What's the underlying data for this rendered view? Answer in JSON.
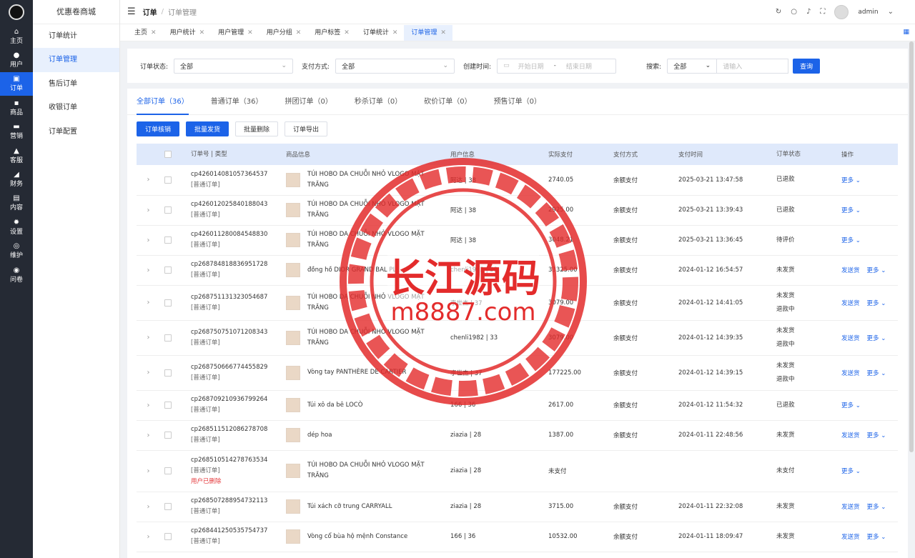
{
  "rail": {
    "items": [
      {
        "label": "主页",
        "icon": "home-icon",
        "glyph": "⌂"
      },
      {
        "label": "用户",
        "icon": "user-icon",
        "glyph": "●"
      },
      {
        "label": "订单",
        "icon": "order-icon",
        "glyph": "▣"
      },
      {
        "label": "商品",
        "icon": "goods-icon",
        "glyph": "▪"
      },
      {
        "label": "营销",
        "icon": "marketing-icon",
        "glyph": "▬"
      },
      {
        "label": "客服",
        "icon": "service-icon",
        "glyph": "▲"
      },
      {
        "label": "财务",
        "icon": "finance-icon",
        "glyph": "◢"
      },
      {
        "label": "内容",
        "icon": "content-icon",
        "glyph": "▤"
      },
      {
        "label": "设置",
        "icon": "settings-icon",
        "glyph": "✹"
      },
      {
        "label": "维护",
        "icon": "maintenance-icon",
        "glyph": "◎"
      },
      {
        "label": "问卷",
        "icon": "survey-icon",
        "glyph": "◉"
      }
    ]
  },
  "subnav": {
    "title": "优惠卷商城",
    "items": [
      {
        "label": "订单统计"
      },
      {
        "label": "订单管理"
      },
      {
        "label": "售后订单"
      },
      {
        "label": "收银订单"
      },
      {
        "label": "订单配置"
      }
    ]
  },
  "topbar": {
    "breadcrumb1": "订单",
    "breadcrumb_sep": "/",
    "breadcrumb2": "订单管理",
    "username": "admin"
  },
  "tabs": [
    {
      "label": "主页"
    },
    {
      "label": "用户统计"
    },
    {
      "label": "用户管理"
    },
    {
      "label": "用户分组"
    },
    {
      "label": "用户标签"
    },
    {
      "label": "订单统计"
    },
    {
      "label": "订单管理"
    }
  ],
  "filters": {
    "status_label": "订单状态:",
    "status_value": "全部",
    "pay_label": "支付方式:",
    "pay_value": "全部",
    "time_label": "创建时间:",
    "date_start": "开始日期",
    "date_sep": "-",
    "date_end": "结束日期",
    "search_label": "搜索:",
    "search_scope": "全部",
    "search_placeholder": "请输入",
    "query_label": "查询"
  },
  "order_tabs": [
    {
      "label": "全部订单（36）"
    },
    {
      "label": "普通订单（36）"
    },
    {
      "label": "拼团订单（0）"
    },
    {
      "label": "秒杀订单（0）"
    },
    {
      "label": "砍价订单（0）"
    },
    {
      "label": "预售订单（0）"
    }
  ],
  "actions": {
    "verify": "订单核销",
    "batch_ship": "批量发货",
    "batch_delete": "批量删除",
    "export": "订单导出"
  },
  "table": {
    "headers": {
      "order_no": "订单号 | 类型",
      "goods": "商品信息",
      "user": "用户信息",
      "paid": "实际支付",
      "method": "支付方式",
      "time": "支付时间",
      "status": "订单状态",
      "op": "操作"
    },
    "rows": [
      {
        "no": "cp426014081057364537",
        "type": "[普通订单]",
        "goods": "TÚI HOBO DA CHUỖI NHỎ VLOGO MẶT TRĂNG",
        "user": "阿达 | 38",
        "paid": "2740.05",
        "method": "余额支付",
        "time": "2025-03-21 13:47:58",
        "status": "已退款",
        "status2": "",
        "ship": "",
        "more": "更多 ⌄",
        "deleted": ""
      },
      {
        "no": "cp426012025840188043",
        "type": "[普通订单]",
        "goods": "TÚI HOBO DA CHUỖI NHỎ VLOGO MẶT TRĂNG",
        "user": "阿达 | 38",
        "paid": "2925.00",
        "method": "余额支付",
        "time": "2025-03-21 13:39:43",
        "status": "已退款",
        "status2": "",
        "ship": "",
        "more": "更多 ⌄",
        "deleted": ""
      },
      {
        "no": "cp426011280084548830",
        "type": "[普通订单]",
        "goods": "TÚI HOBO DA CHUỖI NHỎ VLOGO MẶT TRĂNG",
        "user": "阿达 | 38",
        "paid": "3048.21",
        "method": "余额支付",
        "time": "2025-03-21 13:36:45",
        "status": "待评价",
        "status2": "",
        "ship": "",
        "more": "更多 ⌄",
        "deleted": ""
      },
      {
        "no": "cp268784818836951728",
        "type": "[普通订单]",
        "goods": "đồng hồ DIOR GRAND BAL PL...",
        "user": "chenli1982 | 33",
        "paid": "33325.00",
        "method": "余额支付",
        "time": "2024-01-12 16:54:57",
        "status": "未发货",
        "status2": "",
        "ship": "发送货",
        "more": "更多 ⌄",
        "deleted": ""
      },
      {
        "no": "cp268751131323054687",
        "type": "[普通订单]",
        "goods": "TÚI HOBO DA CHUỖI NHỎ VLOGO MẶT TRĂNG",
        "user": "李世杰 | 37",
        "paid": "3079.00",
        "method": "余额支付",
        "time": "2024-01-12 14:41:05",
        "status": "未发货",
        "status2": "退款中",
        "ship": "发送货",
        "more": "更多 ⌄",
        "deleted": ""
      },
      {
        "no": "cp268750751071208343",
        "type": "[普通订单]",
        "goods": "TÚI HOBO DA CHUỖI NHỎ VLOGO MẶT TRĂNG",
        "user": "chenli1982 | 33",
        "paid": "3079.00",
        "method": "余额支付",
        "time": "2024-01-12 14:39:35",
        "status": "未发货",
        "status2": "退款中",
        "ship": "发送货",
        "more": "更多 ⌄",
        "deleted": ""
      },
      {
        "no": "cp268750666774455829",
        "type": "[普通订单]",
        "goods": "Vòng tay PANTHÈRE DE CARTIER",
        "user": "李世杰 | 37",
        "paid": "177225.00",
        "method": "余额支付",
        "time": "2024-01-12 14:39:15",
        "status": "未发货",
        "status2": "退款中",
        "ship": "发送货",
        "more": "更多 ⌄",
        "deleted": ""
      },
      {
        "no": "cp268709210936799264",
        "type": "[普通订单]",
        "goods": "Túi xô da bê LOCÒ",
        "user": "166 | 36",
        "paid": "2617.00",
        "method": "余额支付",
        "time": "2024-01-12 11:54:32",
        "status": "已退款",
        "status2": "",
        "ship": "",
        "more": "更多 ⌄",
        "deleted": ""
      },
      {
        "no": "cp268511512086278708",
        "type": "[普通订单]",
        "goods": "dép hoa",
        "user": "ziazia | 28",
        "paid": "1387.00",
        "method": "余额支付",
        "time": "2024-01-11 22:48:56",
        "status": "未发货",
        "status2": "",
        "ship": "发送货",
        "more": "更多 ⌄",
        "deleted": ""
      },
      {
        "no": "cp268510514278763534",
        "type": "[普通订单]",
        "goods": "TÚI HOBO DA CHUỖI NHỎ VLOGO MẶT TRĂNG",
        "user": "ziazia | 28",
        "paid": "未支付",
        "method": "",
        "time": "",
        "status": "未支付",
        "status2": "",
        "ship": "",
        "more": "更多 ⌄",
        "deleted": "用户已删除"
      },
      {
        "no": "cp268507288954732113",
        "type": "[普通订单]",
        "goods": "Túi xách cỡ trung CARRYALL",
        "user": "ziazia | 28",
        "paid": "3715.00",
        "method": "余额支付",
        "time": "2024-01-11 22:32:08",
        "status": "未发货",
        "status2": "",
        "ship": "发送货",
        "more": "更多 ⌄",
        "deleted": ""
      },
      {
        "no": "cp268441250535754737",
        "type": "[普通订单]",
        "goods": "Vòng cổ bùa hộ mệnh Constance",
        "user": "166 | 36",
        "paid": "10532.00",
        "method": "余额支付",
        "time": "2024-01-11 18:09:47",
        "status": "未发货",
        "status2": "",
        "ship": "发送货",
        "more": "更多 ⌄",
        "deleted": ""
      }
    ]
  },
  "watermark": {
    "line1": "长江源码",
    "line2": "m8887.com"
  }
}
